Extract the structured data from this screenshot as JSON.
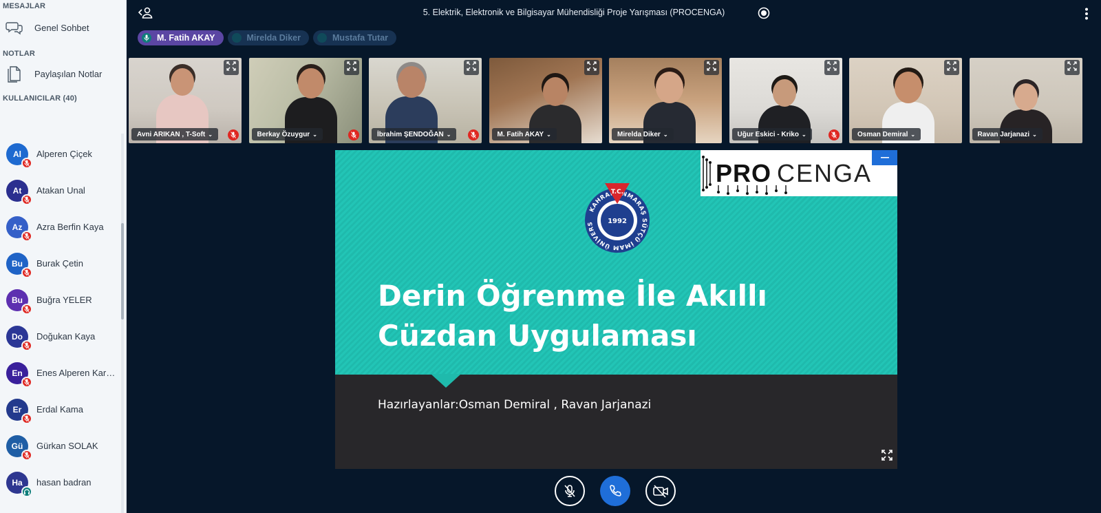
{
  "sidebar": {
    "messages_header": "MESAJLAR",
    "public_chat": "Genel Sohbet",
    "notes_header": "NOTLAR",
    "shared_notes": "Paylaşılan Notlar",
    "users_header": "KULLANICILAR (40)",
    "users": [
      {
        "initials": "Al",
        "name": "Alperen Çiçek",
        "color": "#1e6ad0",
        "status": "muted"
      },
      {
        "initials": "At",
        "name": "Atakan Unal",
        "color": "#2b2f8f",
        "status": "muted"
      },
      {
        "initials": "Az",
        "name": "Azra Berfin Kaya",
        "color": "#3560c8",
        "status": "muted"
      },
      {
        "initials": "Bu",
        "name": "Burak Çetin",
        "color": "#1f63c6",
        "status": "muted"
      },
      {
        "initials": "Bu",
        "name": "Buğra YELER",
        "color": "#5d2fb0",
        "status": "muted"
      },
      {
        "initials": "Do",
        "name": "Doğukan Kaya",
        "color": "#2b3796",
        "status": "muted"
      },
      {
        "initials": "En",
        "name": "Enes Alperen Karabacak",
        "color": "#3a209b",
        "status": "muted"
      },
      {
        "initials": "Er",
        "name": "Erdal Kama",
        "color": "#233a8d",
        "status": "muted"
      },
      {
        "initials": "Gü",
        "name": "Gürkan SOLAK",
        "color": "#1f5ea5",
        "status": "muted"
      },
      {
        "initials": "Ha",
        "name": "hasan badran",
        "color": "#2e3790",
        "status": "listen"
      }
    ]
  },
  "topbar": {
    "meeting_title": "5. Elektrik, Elektronik ve Bilgisayar Mühendisliği Proje Yarışması (PROCENGA)"
  },
  "talkers": [
    {
      "name": "M. Fatih AKAY",
      "active": true
    },
    {
      "name": "Mirelda Diker",
      "active": false
    },
    {
      "name": "Mustafa Tutar",
      "active": false
    }
  ],
  "videos": [
    {
      "name": "Avni ARIKAN , T-Soft",
      "muted": true
    },
    {
      "name": "Berkay Özuygur",
      "muted": true
    },
    {
      "name": "İbrahim ŞENDOĞAN",
      "muted": true
    },
    {
      "name": "M. Fatih AKAY",
      "muted": false
    },
    {
      "name": "Mirelda Diker",
      "muted": false
    },
    {
      "name": "Uğur Eskici - Kriko",
      "muted": true
    },
    {
      "name": "Osman Demiral",
      "muted": false
    },
    {
      "name": "Ravan Jarjanazi",
      "muted": false
    }
  ],
  "presentation": {
    "logo_pro": "PRO",
    "logo_cenga": "CENGA",
    "seal_top": "T.C.",
    "seal_ring": "KAHRAMANMARAŞ SÜTÇÜ İMAM ÜNİVERSİTESİ",
    "seal_year": "1992",
    "title": "Derin Öğrenme İle Akıllı\nCüzdan Uygulaması",
    "authors": "Hazırlayanlar:Osman Demiral , Ravan Jarjanazi"
  },
  "colors": {
    "background": "#06172a",
    "accent_blue": "#1f6ed8",
    "slide_teal": "#22c5b6",
    "muted_red": "#df2721",
    "talker_active": "#5b46a3"
  }
}
